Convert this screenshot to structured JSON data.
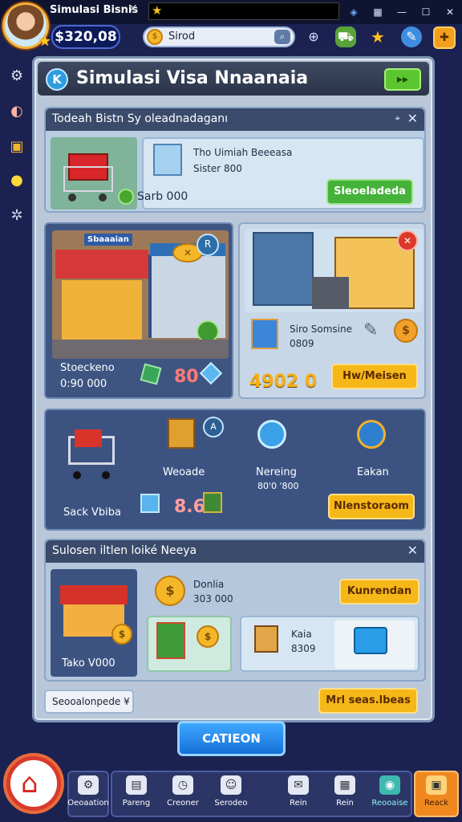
{
  "titlebar": {
    "title": "Simulasi Bisnis",
    "close_tab": "✕"
  },
  "hud": {
    "money": "$320,08",
    "search_text": "Sirod",
    "icons": [
      "radar-icon",
      "truck-icon",
      "star-icon",
      "wrench-icon",
      "plus-icon"
    ]
  },
  "main": {
    "title": "Simulasi Visa Nnaanaia",
    "header_button": "▸▸"
  },
  "section1": {
    "heading": "Todeah Bistn Sy oleadnadaganı",
    "card_title": "Tho Uimiah Beeeasa",
    "card_subtitle": "Sister 800",
    "price": "Sarb 000",
    "button": "Sleoeladeda"
  },
  "shop_left": {
    "label": "Stoeckeno",
    "value": "0:90 000",
    "count": "80",
    "sign_text": "Sbaaaian"
  },
  "shop_right": {
    "item_name": "Siro Somsine",
    "item_value": "0809",
    "amount": "4902 0",
    "button": "Hw/Meisen"
  },
  "section2": {
    "cart_label": "Sack Vbiba",
    "count": "8.6",
    "col1_label": "Weoade",
    "col2_label": "Nereing",
    "col2_value": "80'0 '800",
    "col3_label": "Eakan",
    "button": "Nlenstoraom"
  },
  "section3": {
    "heading": "Sulosen iltlen loiké Neeya",
    "shop_label": "Tako V000",
    "coin_label": "Donlia",
    "coin_value": "303 000",
    "button_top": "Kunrendan",
    "item_label": "Kaia",
    "item_value": "8309",
    "select_label": "Seooalonpede ¥",
    "button_bottom": "Mrl seas.lbeas"
  },
  "footer": {
    "cta": "CATIEON",
    "nav": [
      {
        "icon": "gear-icon",
        "label": "Oeoaation"
      },
      {
        "icon": "chart-icon",
        "label": "Pareng"
      },
      {
        "icon": "clock-icon",
        "label": "Creoner"
      },
      {
        "icon": "user-icon",
        "label": "Serodeo"
      },
      {
        "icon": "mail-icon",
        "label": "Rein"
      },
      {
        "icon": "grid-icon",
        "label": "Rein"
      },
      {
        "icon": "globe-icon",
        "label": "Reooaise"
      },
      {
        "icon": "bag-icon",
        "label": "Reack"
      }
    ]
  },
  "colors": {
    "background": "#1b2150",
    "panel": "#b9c7d8",
    "card_blue": "#4d628a",
    "accent_green": "#45b23a",
    "accent_yellow": "#f6b719",
    "accent_blue": "#1570d8"
  }
}
